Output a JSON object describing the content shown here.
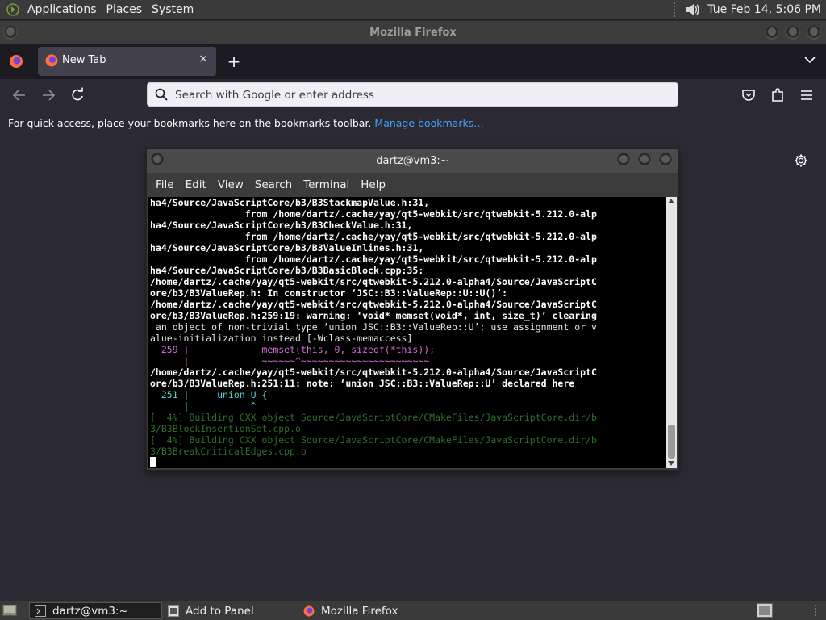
{
  "top_panel": {
    "menus": [
      "Applications",
      "Places",
      "System"
    ],
    "clock": "Tue Feb 14,  5:06 PM",
    "icons": [
      "gnome-logo-icon",
      "volume-icon"
    ]
  },
  "firefox": {
    "window_title": "Mozilla Firefox",
    "tab": {
      "title": "New Tab",
      "close": "×"
    },
    "new_tab": "+",
    "urlbar": {
      "placeholder": "Search with Google or enter address",
      "value": ""
    },
    "bookmarks_bar": {
      "message": "For quick access, place your bookmarks here on the bookmarks toolbar.",
      "link": "Manage bookmarks…"
    }
  },
  "terminal": {
    "title": "dartz@vm3:~",
    "menus": [
      "File",
      "Edit",
      "View",
      "Search",
      "Terminal",
      "Help"
    ],
    "lines": [
      "ha4/Source/JavaScriptCore/b3/B3StackmapValue.h:31,",
      "                 from /home/dartz/.cache/yay/qt5-webkit/src/qtwebkit-5.212.0-alp",
      "ha4/Source/JavaScriptCore/b3/B3CheckValue.h:31,",
      "                 from /home/dartz/.cache/yay/qt5-webkit/src/qtwebkit-5.212.0-alp",
      "ha4/Source/JavaScriptCore/b3/B3ValueInlines.h:31,",
      "                 from /home/dartz/.cache/yay/qt5-webkit/src/qtwebkit-5.212.0-alp",
      "ha4/Source/JavaScriptCore/b3/B3BasicBlock.cpp:35:",
      "/home/dartz/.cache/yay/qt5-webkit/src/qtwebkit-5.212.0-alpha4/Source/JavaScriptC",
      "ore/b3/B3ValueRep.h: In constructor ‘JSC::B3::ValueRep::U::U()’:",
      "/home/dartz/.cache/yay/qt5-webkit/src/qtwebkit-5.212.0-alpha4/Source/JavaScriptC",
      "ore/b3/B3ValueRep.h:259:19: warning: ‘void* memset(void*, int, size_t)’ clearing",
      " an object of non-trivial type ‘union JSC::B3::ValueRep::U’; use assignment or v",
      "alue-initialization instead [-Wclass-memaccess]",
      "  259 |             memset(this, 0, sizeof(*this));",
      "      |             ~~~~~~^~~~~~~~~~~~~~~~~~~~~~~~",
      "/home/dartz/.cache/yay/qt5-webkit/src/qtwebkit-5.212.0-alpha4/Source/JavaScriptC",
      "ore/b3/B3ValueRep.h:251:11: note: ‘union JSC::B3::ValueRep::U’ declared here",
      "  251 |     union U {",
      "      |           ^",
      "[  4%] Building CXX object Source/JavaScriptCore/CMakeFiles/JavaScriptCore.dir/b",
      "3/B3BlockInsertionSet.cpp.o",
      "[  4%] Building CXX object Source/JavaScriptCore/CMakeFiles/JavaScriptCore.dir/b",
      "3/B3BreakCriticalEdges.cpp.o"
    ]
  },
  "taskbar": {
    "items": [
      {
        "label": "dartz@vm3:~",
        "icon": "terminal-icon",
        "active": true
      },
      {
        "label": "Add to Panel",
        "icon": "add-to-panel-icon",
        "active": false
      },
      {
        "label": "Mozilla Firefox",
        "icon": "firefox-icon",
        "active": false
      }
    ]
  }
}
